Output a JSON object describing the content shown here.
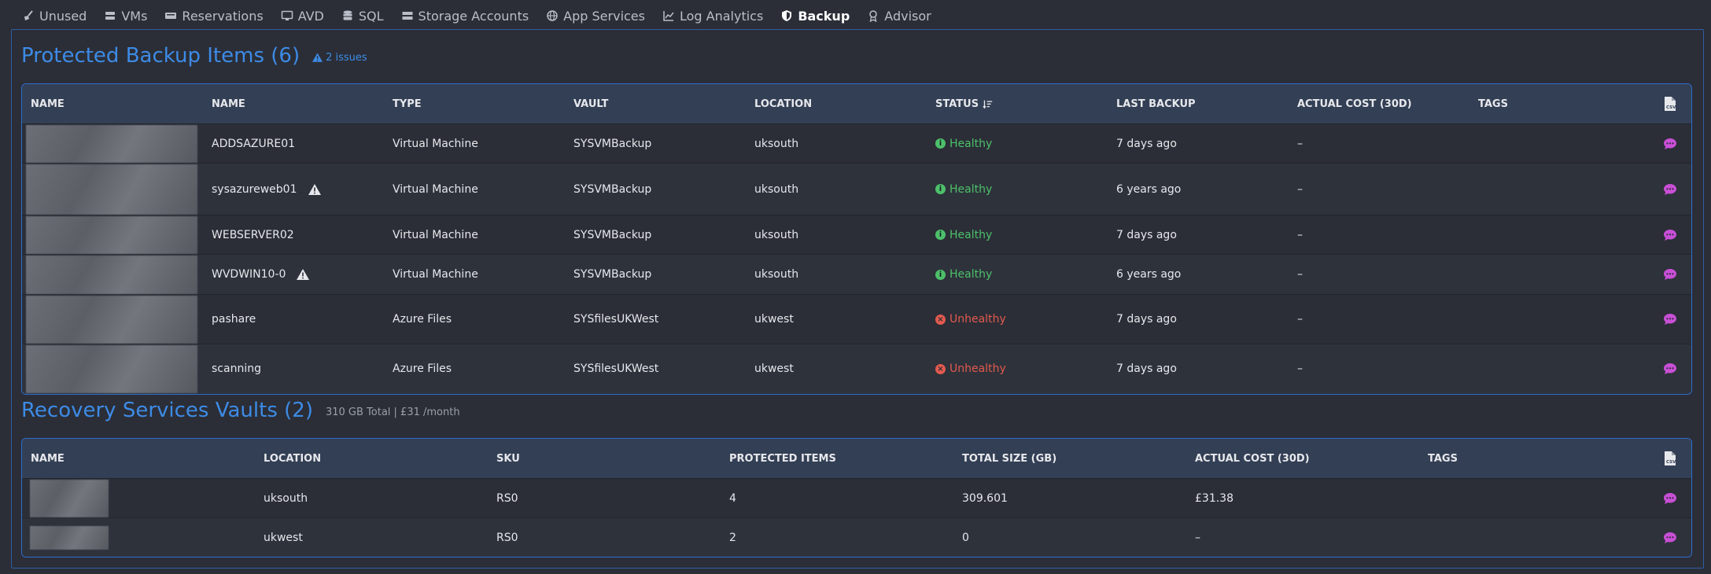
{
  "nav": {
    "tabs": [
      {
        "label": "Unused",
        "icon": "broom-icon",
        "active": false
      },
      {
        "label": "VMs",
        "icon": "server-icon",
        "active": false
      },
      {
        "label": "Reservations",
        "icon": "reservation-icon",
        "active": false
      },
      {
        "label": "AVD",
        "icon": "desktop-icon",
        "active": false
      },
      {
        "label": "SQL",
        "icon": "database-icon",
        "active": false
      },
      {
        "label": "Storage Accounts",
        "icon": "storage-icon",
        "active": false
      },
      {
        "label": "App Services",
        "icon": "globe-icon",
        "active": false
      },
      {
        "label": "Log Analytics",
        "icon": "line-chart-icon",
        "active": false
      },
      {
        "label": "Backup",
        "icon": "shield-icon",
        "active": true
      },
      {
        "label": "Advisor",
        "icon": "award-icon",
        "active": false
      }
    ]
  },
  "backup_items": {
    "title": "Protected Backup Items (6)",
    "issues": "2 issues",
    "columns": [
      "Name",
      "Name",
      "Type",
      "Vault",
      "Location",
      "Status",
      "Last Backup",
      "Actual Cost (30D)",
      "Tags"
    ],
    "rows": [
      {
        "name": "ADDSAZURE01",
        "warning": false,
        "type": "Virtual Machine",
        "vault": "SYSVMBackup",
        "location": "uksouth",
        "status": "Healthy",
        "healthy": true,
        "last_backup": "7 days ago",
        "cost": "–",
        "tags": ""
      },
      {
        "name": "sysazureweb01",
        "warning": true,
        "type": "Virtual Machine",
        "vault": "SYSVMBackup",
        "location": "uksouth",
        "status": "Healthy",
        "healthy": true,
        "last_backup": "6 years ago",
        "cost": "–",
        "tags": ""
      },
      {
        "name": "WEBSERVER02",
        "warning": false,
        "type": "Virtual Machine",
        "vault": "SYSVMBackup",
        "location": "uksouth",
        "status": "Healthy",
        "healthy": true,
        "last_backup": "7 days ago",
        "cost": "–",
        "tags": ""
      },
      {
        "name": "WVDWIN10-0",
        "warning": true,
        "type": "Virtual Machine",
        "vault": "SYSVMBackup",
        "location": "uksouth",
        "status": "Healthy",
        "healthy": true,
        "last_backup": "6 years ago",
        "cost": "–",
        "tags": ""
      },
      {
        "name": "pashare",
        "warning": false,
        "type": "Azure Files",
        "vault": "SYSfilesUKWest",
        "location": "ukwest",
        "status": "Unhealthy",
        "healthy": false,
        "last_backup": "7 days ago",
        "cost": "–",
        "tags": ""
      },
      {
        "name": "scanning",
        "warning": false,
        "type": "Azure Files",
        "vault": "SYSfilesUKWest",
        "location": "ukwest",
        "status": "Unhealthy",
        "healthy": false,
        "last_backup": "7 days ago",
        "cost": "–",
        "tags": ""
      }
    ]
  },
  "vaults": {
    "title": "Recovery Services Vaults (2)",
    "summary": "310 GB Total | £31 /month",
    "columns": [
      "Name",
      "Location",
      "SKU",
      "Protected Items",
      "Total Size (GB)",
      "Actual Cost (30D)",
      "Tags"
    ],
    "rows": [
      {
        "location": "uksouth",
        "sku": "RS0",
        "protected_items": "4",
        "total_size": "309.601",
        "cost": "£31.38",
        "tags": ""
      },
      {
        "location": "ukwest",
        "sku": "RS0",
        "protected_items": "2",
        "total_size": "0",
        "cost": "–",
        "tags": ""
      }
    ]
  },
  "colors": {
    "accent": "#3d8be6",
    "healthy": "#4cc06a",
    "unhealthy": "#e25a4e",
    "comment": "#c94fd6"
  }
}
